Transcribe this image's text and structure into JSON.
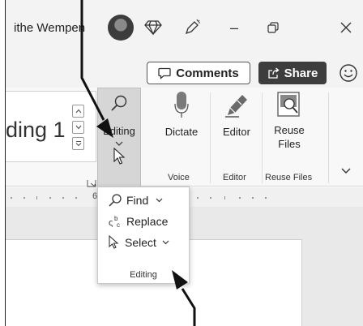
{
  "titlebar": {
    "user_name": "ithe Wempen",
    "minimize_glyph": "–",
    "restore_glyph": "⧉",
    "close_glyph": "✕"
  },
  "header": {
    "comments_label": "Comments",
    "share_label": "Share"
  },
  "ribbon": {
    "style_preview": "ding 1",
    "buttons": [
      {
        "label": "Editing",
        "icon": "search-icon"
      },
      {
        "label": "Dictate",
        "icon": "microphone-icon"
      },
      {
        "label": "Editor",
        "icon": "editor-pen-icon"
      },
      {
        "label_line1": "Reuse",
        "label_line2": "Files",
        "icon": "reuse-files-icon"
      }
    ],
    "group_labels": {
      "voice": "Voice",
      "editor": "Editor",
      "reuse_files": "Reuse Files"
    }
  },
  "ruler": {
    "number": "6"
  },
  "editing_menu": {
    "items": [
      {
        "label": "Find",
        "icon": "search-icon",
        "has_dropdown": true
      },
      {
        "label": "Replace",
        "icon": "replace-icon",
        "has_dropdown": false
      },
      {
        "label": "Select",
        "icon": "cursor-icon",
        "has_dropdown": true
      }
    ],
    "caption": "Editing"
  },
  "colors": {
    "share_bg": "#3d3d3d",
    "editing_selected_bg": "#d6d6d6",
    "titlebar_bg": "#f3f3f3"
  }
}
